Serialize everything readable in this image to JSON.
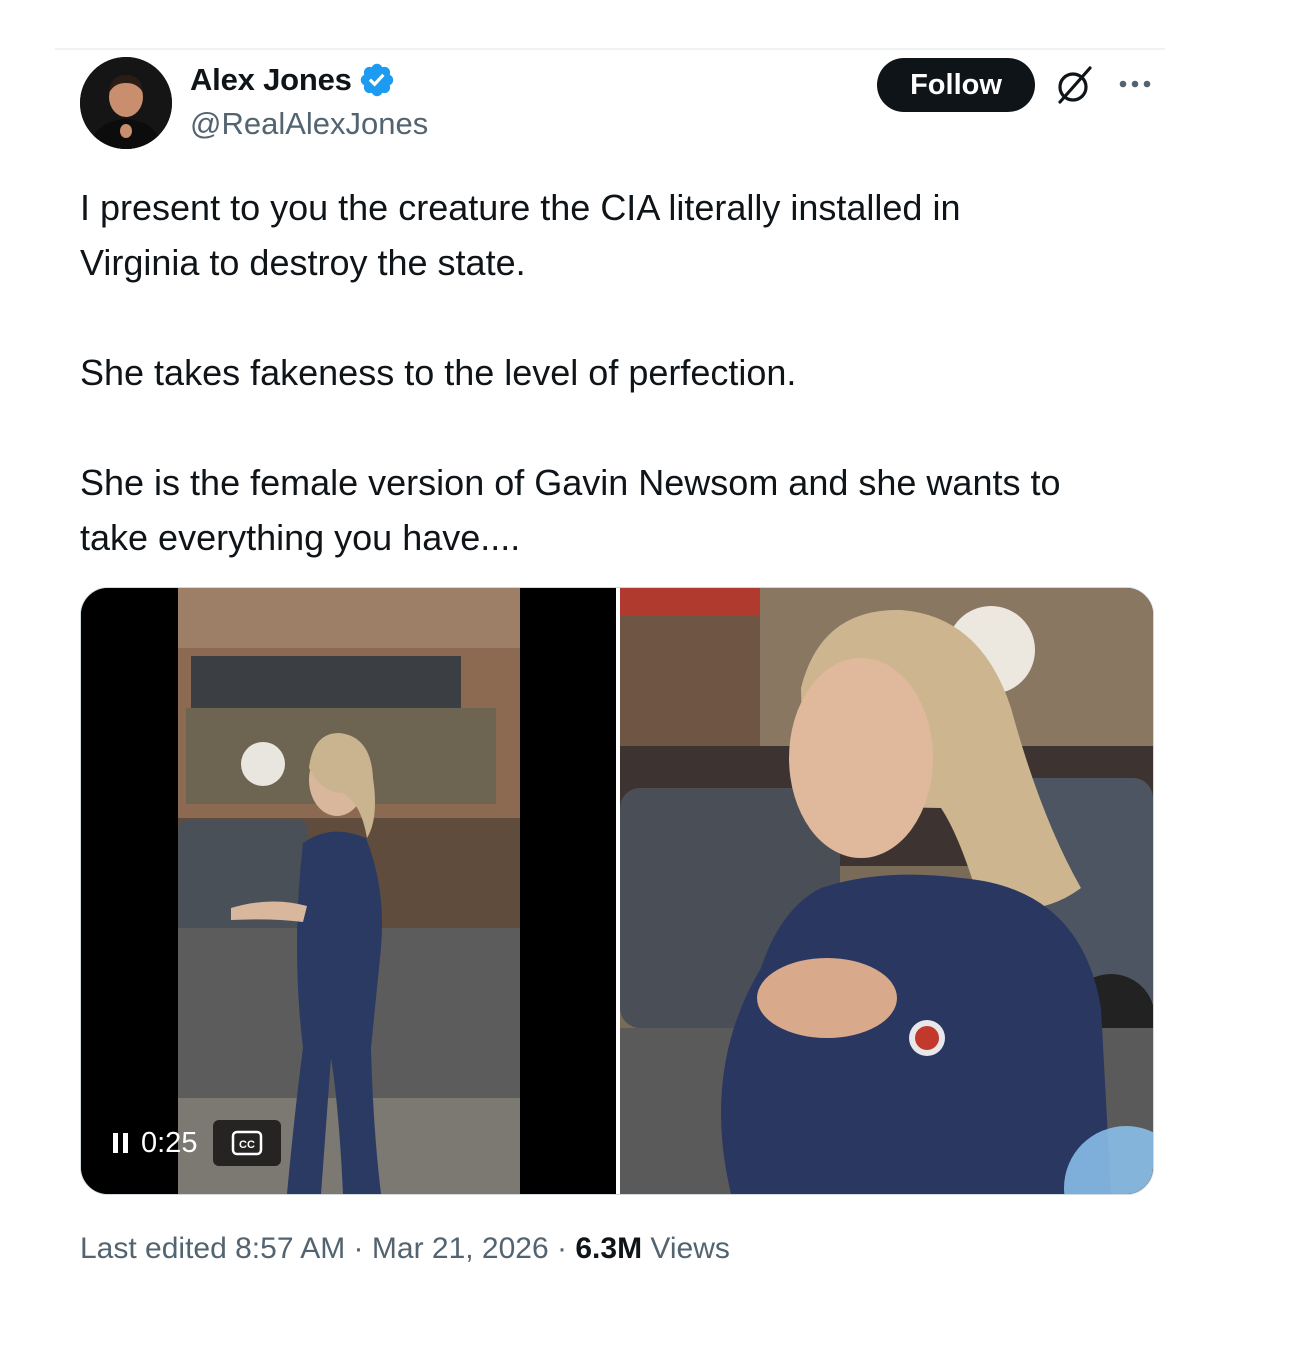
{
  "author": {
    "display_name": "Alex Jones",
    "handle": "@RealAlexJones",
    "verified": true
  },
  "actions": {
    "follow_label": "Follow",
    "grok_icon": "grok-icon",
    "more_icon": "more-icon"
  },
  "tweet": {
    "paragraphs": [
      "I present to you the creature the CIA literally installed in\nVirginia to destroy the state.",
      "She takes fakeness to the level of perfection.",
      "She is the female version of Gavin Newsom and she wants to\ntake everything you have...."
    ]
  },
  "video": {
    "elapsed": "0:25",
    "state": "playing",
    "captions_label": "CC"
  },
  "meta": {
    "edited_prefix": "Last edited",
    "time": "8:57 AM",
    "separator": "·",
    "date": "Mar 21, 2026",
    "views_count": "6.3M",
    "views_label": "Views"
  },
  "colors": {
    "text_primary": "#0f1419",
    "text_secondary": "#536471",
    "verified_blue": "#1d9bf0",
    "button_dark": "#0f1419"
  }
}
